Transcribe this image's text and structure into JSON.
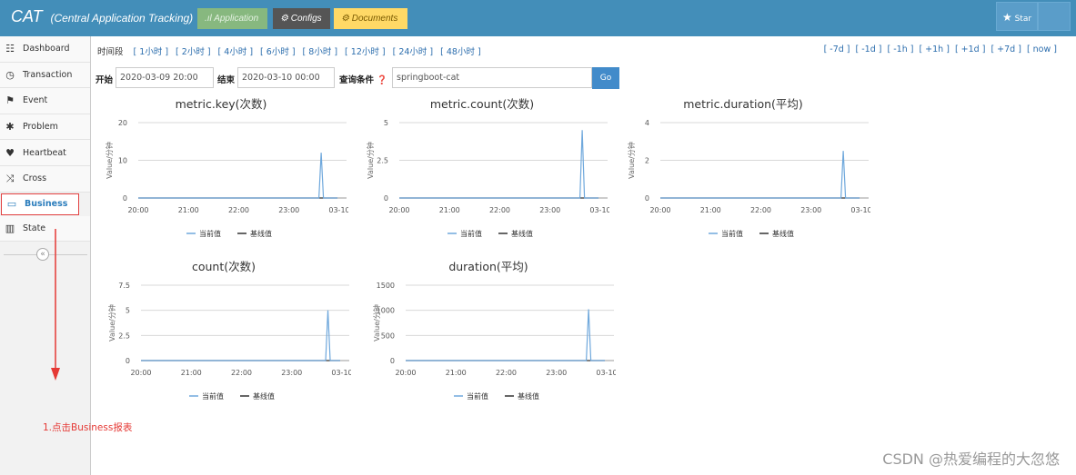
{
  "header": {
    "brand_short": "CAT",
    "brand_full": "(Central Application Tracking)",
    "nav": [
      {
        "label": "Application",
        "icon": "bar-chart-icon"
      },
      {
        "label": "Configs",
        "icon": "gears-icon"
      },
      {
        "label": "Documents",
        "icon": "gears-icon"
      }
    ],
    "star_label": "Star"
  },
  "sidebar": {
    "items": [
      {
        "label": "Dashboard",
        "icon": "dashboard-icon",
        "glyph": "☷"
      },
      {
        "label": "Transaction",
        "icon": "clock-icon",
        "glyph": "◷"
      },
      {
        "label": "Event",
        "icon": "flag-icon",
        "glyph": "⚑"
      },
      {
        "label": "Problem",
        "icon": "bug-icon",
        "glyph": "✱"
      },
      {
        "label": "Heartbeat",
        "icon": "heart-icon",
        "glyph": "♥"
      },
      {
        "label": "Cross",
        "icon": "random-icon",
        "glyph": "⤨"
      },
      {
        "label": "Business",
        "icon": "business-icon",
        "glyph": "▭"
      },
      {
        "label": "State",
        "icon": "bar-chart-icon",
        "glyph": "▥"
      }
    ],
    "collapse_glyph": "«"
  },
  "timebar": {
    "label": "时间段",
    "ranges": [
      "[ 1小时 ]",
      "[ 2小时 ]",
      "[ 4小时 ]",
      "[ 6小时 ]",
      "[ 8小时 ]",
      "[ 12小时 ]",
      "[ 24小时 ]",
      "[ 48小时 ]"
    ],
    "offsets": [
      "[ -7d ]",
      "[ -1d ]",
      "[ -1h ]",
      "[ +1h ]",
      "[ +1d ]",
      "[ +7d ]",
      "[ now ]"
    ]
  },
  "filter": {
    "start_label": "开始",
    "start_value": "2020-03-09 20:00",
    "end_label": "结束",
    "end_value": "2020-03-10 00:00",
    "query_label": "查询条件 ❓",
    "query_value": "springboot-cat",
    "go_label": "Go"
  },
  "chart_data": [
    {
      "type": "line",
      "title": "metric.key(次数)",
      "ylabel": "Value/分钟",
      "ylim": [
        0,
        20
      ],
      "yticks": [
        0,
        10,
        20
      ],
      "xticks": [
        "20:00",
        "21:00",
        "22:00",
        "23:00",
        "03-10"
      ],
      "spike_x": 0.91,
      "spike_value": 12,
      "series": [
        {
          "name": "当前值",
          "color": "#6fa8dc"
        },
        {
          "name": "基线值",
          "color": "#333333"
        }
      ]
    },
    {
      "type": "line",
      "title": "metric.count(次数)",
      "ylabel": "Value/分钟",
      "ylim": [
        0,
        5
      ],
      "yticks": [
        0,
        2.5,
        5
      ],
      "xticks": [
        "20:00",
        "21:00",
        "22:00",
        "23:00",
        "03-10"
      ],
      "spike_x": 0.91,
      "spike_value": 4.5,
      "series": [
        {
          "name": "当前值",
          "color": "#6fa8dc"
        },
        {
          "name": "基线值",
          "color": "#333333"
        }
      ]
    },
    {
      "type": "line",
      "title": "metric.duration(平均)",
      "ylabel": "Value/分钟",
      "ylim": [
        0,
        4
      ],
      "yticks": [
        0,
        2,
        4
      ],
      "xticks": [
        "20:00",
        "21:00",
        "22:00",
        "23:00",
        "03-10"
      ],
      "spike_x": 0.91,
      "spike_value": 2.5,
      "series": [
        {
          "name": "当前值",
          "color": "#6fa8dc"
        },
        {
          "name": "基线值",
          "color": "#333333"
        }
      ]
    },
    {
      "type": "line",
      "title": "count(次数)",
      "ylabel": "Value/分钟",
      "ylim": [
        0,
        7.5
      ],
      "yticks": [
        0,
        2.5,
        5,
        7.5
      ],
      "xticks": [
        "20:00",
        "21:00",
        "22:00",
        "23:00",
        "03-10"
      ],
      "spike_x": 0.93,
      "spike_value": 5,
      "series": [
        {
          "name": "当前值",
          "color": "#6fa8dc"
        },
        {
          "name": "基线值",
          "color": "#333333"
        }
      ]
    },
    {
      "type": "line",
      "title": "duration(平均)",
      "ylabel": "Value/分钟",
      "ylim": [
        0,
        1500
      ],
      "yticks": [
        0,
        500,
        1000,
        1500
      ],
      "xticks": [
        "20:00",
        "21:00",
        "22:00",
        "23:00",
        "03-10"
      ],
      "spike_x": 0.91,
      "spike_value": 1020,
      "series": [
        {
          "name": "当前值",
          "color": "#6fa8dc"
        },
        {
          "name": "基线值",
          "color": "#333333"
        }
      ]
    }
  ],
  "annotation": {
    "text": "1.点击Business报表",
    "color": "#e53935"
  },
  "watermark": "CSDN @热爱编程的大忽悠"
}
